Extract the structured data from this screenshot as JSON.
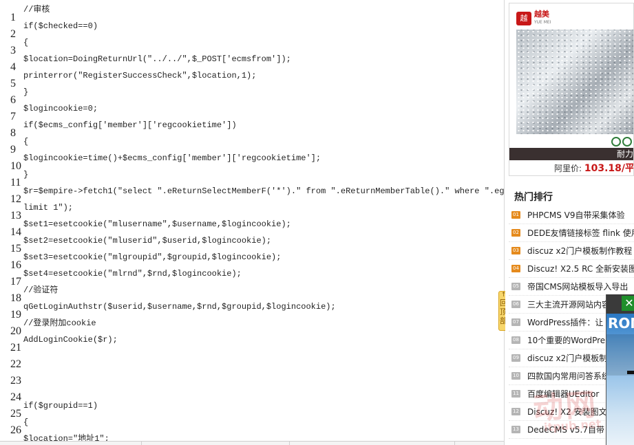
{
  "code_editor": {
    "line_numbers": [
      "1",
      "2",
      "3",
      "4",
      "5",
      "6",
      "7",
      "8",
      "9",
      "10",
      "11",
      "12",
      "13",
      "14",
      "15",
      "16",
      "17",
      "18",
      "19",
      "20",
      "21",
      "22",
      "23",
      "24",
      "25",
      "26"
    ],
    "code_lines": [
      "//审核",
      "if($checked==0)",
      "{",
      "$location=DoingReturnUrl(\"../../\",$_POST['ecmsfrom']);",
      "printerror(\"RegisterSuccessCheck\",$location,1);",
      "}",
      "$logincookie=0;",
      "if($ecms_config['member']['regcookietime'])",
      "{",
      "$logincookie=time()+$ecms_config['member']['regcookietime'];",
      "}",
      "$r=$empire->fetch1(\"select \".eReturnSelectMemberF('*').\" from \".eReturnMemberTable().\" where \".egetmf('userid').\"='$userid'",
      "limit 1\");",
      "$set1=esetcookie(\"mlusername\",$username,$logincookie);",
      "$set2=esetcookie(\"mluserid\",$userid,$logincookie);",
      "$set3=esetcookie(\"mlgroupid\",$groupid,$logincookie);",
      "$set4=esetcookie(\"mlrnd\",$rnd,$logincookie);",
      "//验证符",
      "qGetLoginAuthstr($userid,$username,$rnd,$groupid,$logincookie);",
      "//登录附加cookie",
      "AddLoginCookie($r);",
      "",
      "",
      "",
      "if($groupid==1)",
      "{",
      "$location=\"地址1\";"
    ]
  },
  "back_to_top": {
    "label": "回顶部",
    "arrow": "↑"
  },
  "ad": {
    "brand_mark": "越",
    "brand_name": "越美",
    "brand_sub": "YUE MEI",
    "caption": "耐力",
    "price_label": "阿里价:",
    "price_value": "103.18/平"
  },
  "hot_list": {
    "title": "热门排行",
    "items": [
      {
        "num": "01",
        "text": "PHPCMS V9自带采集体验"
      },
      {
        "num": "02",
        "text": "DEDE友情链接标签 flink 使用"
      },
      {
        "num": "03",
        "text": "discuz x2门户模板制作教程"
      },
      {
        "num": "04",
        "text": "Discuz! X2.5 RC 全新安装图"
      },
      {
        "num": "05",
        "text": "帝国CMS网站模板导入导出"
      },
      {
        "num": "06",
        "text": "三大主流开源网站内容管"
      },
      {
        "num": "07",
        "text": "WordPress插件：让"
      },
      {
        "num": "08",
        "text": "10个重要的WordPre"
      },
      {
        "num": "09",
        "text": "discuz x2门户模板制"
      },
      {
        "num": "10",
        "text": "四款国内常用问答系统"
      },
      {
        "num": "11",
        "text": "百度编辑器UEditor"
      },
      {
        "num": "12",
        "text": "Discuz! X2 安装图文"
      },
      {
        "num": "13",
        "text": "DedeCMS v5.7自带"
      }
    ]
  },
  "float_ad": {
    "close_icon": "✕",
    "brand": "ROM"
  },
  "watermark": {
    "big": "动网",
    "small": "itpub.net"
  },
  "colors": {
    "accent_orange": "#e58a1c",
    "price_red": "#c81818",
    "back_top_yellow": "#f7d66b"
  }
}
